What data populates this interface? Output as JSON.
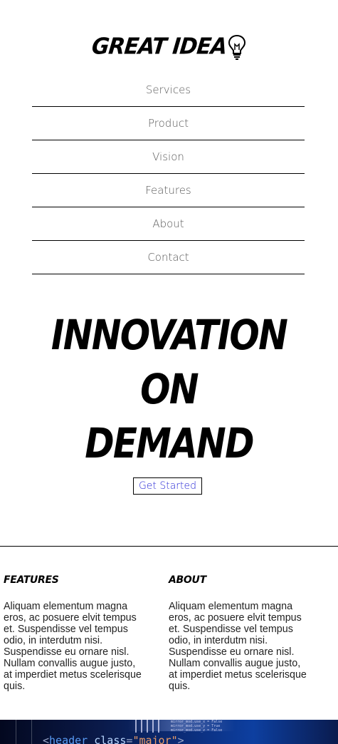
{
  "header": {
    "logo_text": "GREAT IDEA",
    "logo_icon": "lightbulb-icon"
  },
  "nav": {
    "items": [
      {
        "label": "Services"
      },
      {
        "label": "Product"
      },
      {
        "label": "Vision"
      },
      {
        "label": "Features"
      },
      {
        "label": "About"
      },
      {
        "label": "Contact"
      }
    ]
  },
  "hero": {
    "title_lines": [
      "INNOVATION",
      "ON",
      "DEMAND"
    ],
    "cta_label": "Get Started"
  },
  "columns": [
    {
      "heading": "FEATURES",
      "text": "Aliquam elementum magna eros, ac posuere elvit tempus et. Suspendisse vel tempus odio, in interdutm nisi. Suspendisse eu ornare nisl. Nullam convallis augue justo, at imperdiet metus scelerisque quis."
    },
    {
      "heading": "ABOUT",
      "text": "Aliquam elementum magna eros, ac posuere elvit tempus et. Suspendisse vel tempus odio, in interdutm nisi. Suspendisse eu ornare nisl. Nullam convallis augue justo, at imperdiet metus scelerisque quis."
    }
  ],
  "code_strip": {
    "open_bracket": "<",
    "tag": "header",
    "attr": "class",
    "equals": "=",
    "value": "\"major\"",
    "close_bracket": ">",
    "tiny_lines": [
      "mirror_mod.use_x = False",
      "mirror_mod.use_y = True",
      "mirror_mod.use_z = False"
    ]
  },
  "colors": {
    "link_blue": "#2b2bd6",
    "nav_text": "#5a5a5a",
    "border": "#000000"
  }
}
